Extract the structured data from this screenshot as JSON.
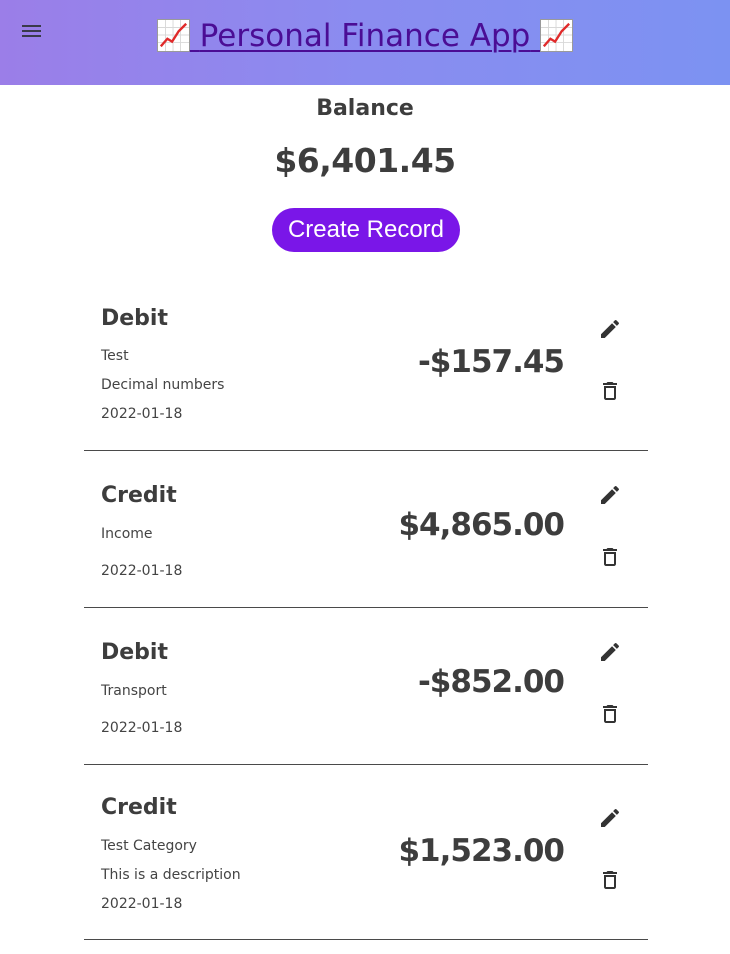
{
  "header": {
    "menu_icon": "hamburger-menu-icon",
    "title_text": "Personal Finance App",
    "title_icon": "chart-increasing-icon",
    "gradient_start": "#9b7ee8",
    "gradient_end": "#7c92f2"
  },
  "balance": {
    "label": "Balance",
    "value": "$6,401.45"
  },
  "create_button": {
    "label": "Create Record",
    "color": "#7a16e8"
  },
  "records": [
    {
      "type": "Debit",
      "category": "Test",
      "description": "Decimal numbers",
      "date": "2022-01-18",
      "amount": "-$157.45"
    },
    {
      "type": "Credit",
      "category": "Income",
      "description": "",
      "date": "2022-01-18",
      "amount": "$4,865.00"
    },
    {
      "type": "Debit",
      "category": "Transport",
      "description": "",
      "date": "2022-01-18",
      "amount": "-$852.00"
    },
    {
      "type": "Credit",
      "category": "Test Category",
      "description": "This is a description",
      "date": "2022-01-18",
      "amount": "$1,523.00"
    }
  ],
  "record_actions": {
    "edit_icon": "pencil-edit-icon",
    "delete_icon": "trash-delete-icon"
  }
}
